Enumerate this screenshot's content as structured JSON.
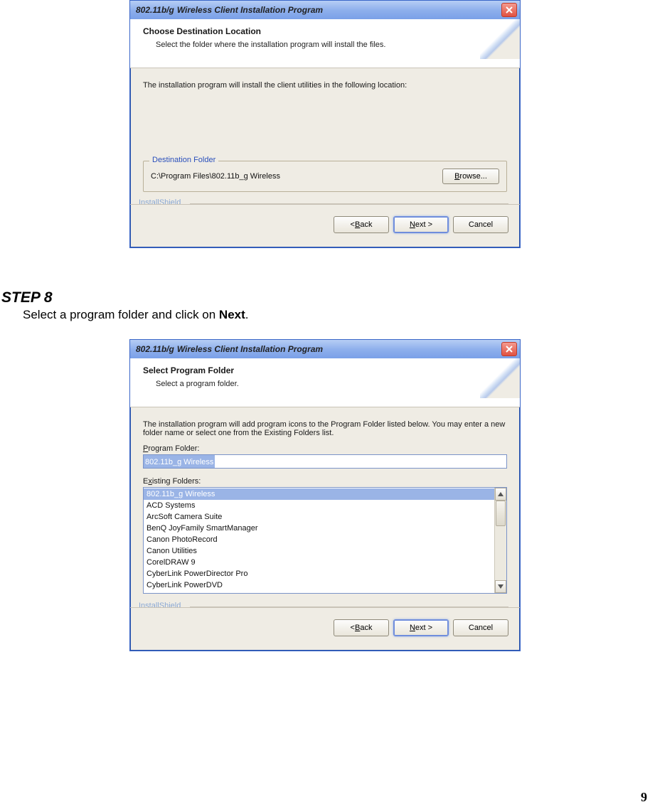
{
  "page_number": "9",
  "step": {
    "label": "STEP 8",
    "desc_before": "Select a program folder and click on ",
    "desc_bold": "Next",
    "desc_after": "."
  },
  "dialog1": {
    "title_a": "802.11b/g",
    "title_b": "Wireless Client Installation Program",
    "header_title": "Choose Destination Location",
    "header_sub": "Select the folder where the installation program will install the files.",
    "body_text": "The installation program will install the client utilities in the following location:",
    "fieldset_legend": "Destination Folder",
    "dest_path": "C:\\Program Files\\802.11b_g Wireless",
    "browse_a": "B",
    "browse_b": "rowse...",
    "brand": "InstallShield",
    "back_a": "< ",
    "back_u": "B",
    "back_b": "ack",
    "next_u": "N",
    "next_b": "ext >",
    "cancel": "Cancel"
  },
  "dialog2": {
    "title_a": "802.11b/g",
    "title_b": "Wireless Client Installation Program",
    "header_title": "Select Program Folder",
    "header_sub": "Select a program folder.",
    "body_text": "The installation program will add program icons to the Program Folder listed below. You may enter a new folder name or select one from the Existing Folders list.",
    "pf_label_u": "P",
    "pf_label_b": "rogram Folder:",
    "pf_value": "802.11b_g Wireless",
    "ef_label_a": "E",
    "ef_label_u": "x",
    "ef_label_b": "isting Folders:",
    "existing_folders": [
      "802.11b_g Wireless",
      "ACD Systems",
      "ArcSoft Camera Suite",
      "BenQ JoyFamily SmartManager",
      "Canon PhotoRecord",
      "Canon Utilities",
      "CorelDRAW 9",
      "CyberLink PowerDirector Pro",
      "CyberLink PowerDVD"
    ],
    "brand": "InstallShield",
    "back_a": "< ",
    "back_u": "B",
    "back_b": "ack",
    "next_u": "N",
    "next_b": "ext >",
    "cancel": "Cancel"
  }
}
